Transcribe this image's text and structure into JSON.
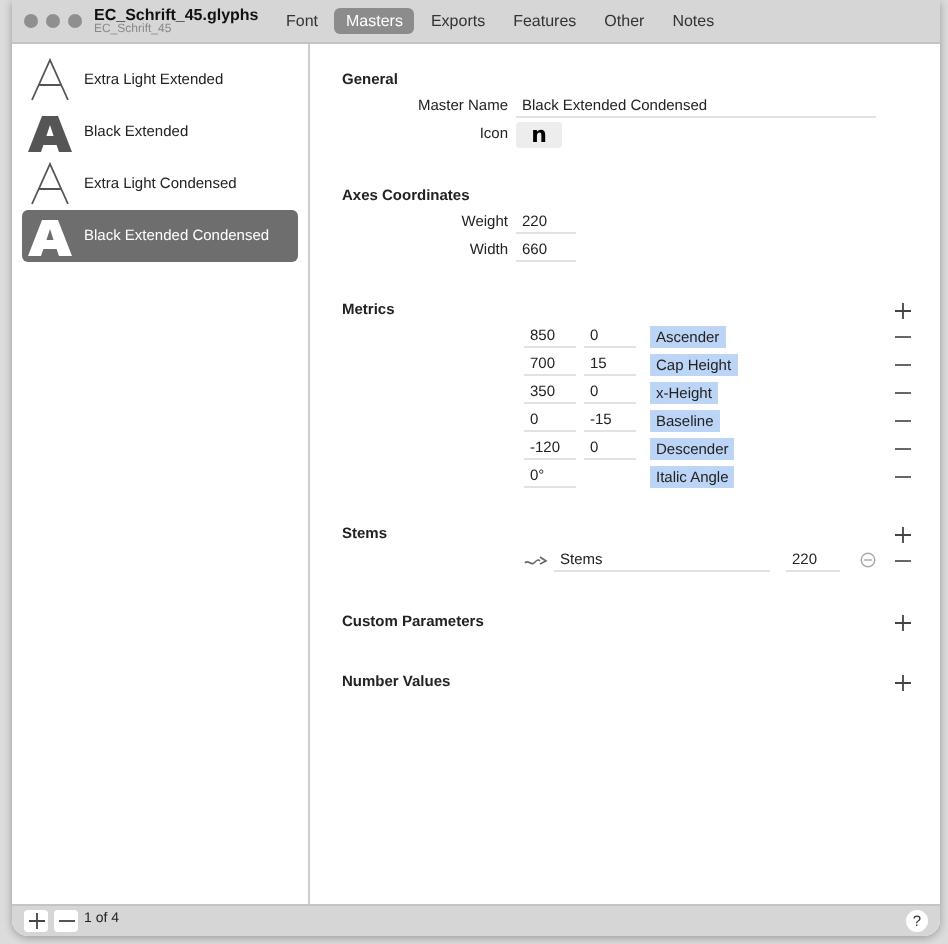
{
  "window": {
    "title": "EC_Schrift_45.glyphs",
    "subtitle": "EC_Schrift_45"
  },
  "tabs": [
    {
      "label": "Font",
      "selected": false
    },
    {
      "label": "Masters",
      "selected": true
    },
    {
      "label": "Exports",
      "selected": false
    },
    {
      "label": "Features",
      "selected": false
    },
    {
      "label": "Other",
      "selected": false
    },
    {
      "label": "Notes",
      "selected": false
    }
  ],
  "masters": [
    {
      "name": "Extra Light Extended",
      "kind": "light",
      "selected": false
    },
    {
      "name": "Black Extended",
      "kind": "black",
      "selected": false
    },
    {
      "name": "Extra Light Condensed",
      "kind": "light",
      "selected": false
    },
    {
      "name": "Black Extended Condensed",
      "kind": "black",
      "selected": true
    }
  ],
  "general": {
    "heading": "General",
    "master_name_label": "Master Name",
    "master_name": "Black Extended Condensed",
    "icon_label": "Icon",
    "icon_glyph": "n"
  },
  "axes": {
    "heading": "Axes Coordinates",
    "rows": [
      {
        "label": "Weight",
        "value": "220"
      },
      {
        "label": "Width",
        "value": "660"
      }
    ]
  },
  "metrics": {
    "heading": "Metrics",
    "rows": [
      {
        "value": "850",
        "overshoot": "0",
        "name": "Ascender"
      },
      {
        "value": "700",
        "overshoot": "15",
        "name": "Cap Height"
      },
      {
        "value": "350",
        "overshoot": "0",
        "name": "x-Height"
      },
      {
        "value": "0",
        "overshoot": "-15",
        "name": "Baseline"
      },
      {
        "value": "-120",
        "overshoot": "0",
        "name": "Descender"
      },
      {
        "value": "0°",
        "name": "Italic Angle"
      }
    ]
  },
  "stems": {
    "heading": "Stems",
    "rows": [
      {
        "name": "Stems",
        "value": "220"
      }
    ]
  },
  "custom_parameters": {
    "heading": "Custom Parameters"
  },
  "number_values": {
    "heading": "Number Values"
  },
  "bottom_bar": {
    "count": "1 of 4",
    "help": "?"
  }
}
